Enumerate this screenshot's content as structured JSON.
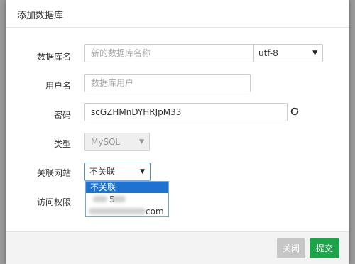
{
  "dialog": {
    "title": "添加数据库"
  },
  "form": {
    "db_name": {
      "label": "数据库名",
      "placeholder": "新的数据库名称"
    },
    "charset": {
      "value": "utf-8"
    },
    "username": {
      "label": "用户名",
      "placeholder": "数据库用户"
    },
    "password": {
      "label": "密码",
      "value": "scGZHMnDYHRJpM33"
    },
    "type": {
      "label": "类型",
      "value": "MySQL"
    },
    "linked_site": {
      "label": "关联网站",
      "value": "不关联",
      "options": [
        "不关联",
        "5",
        "com"
      ]
    },
    "access": {
      "label": "访问权限"
    }
  },
  "footer": {
    "close_label": "关闭",
    "submit_label": "提交"
  },
  "icons": {
    "refresh": "refresh-icon",
    "dropdown": "caret-down-icon"
  },
  "colors": {
    "submit": "#1fa34a",
    "highlight": "#1e73d1",
    "close": "#c6c6c6"
  }
}
